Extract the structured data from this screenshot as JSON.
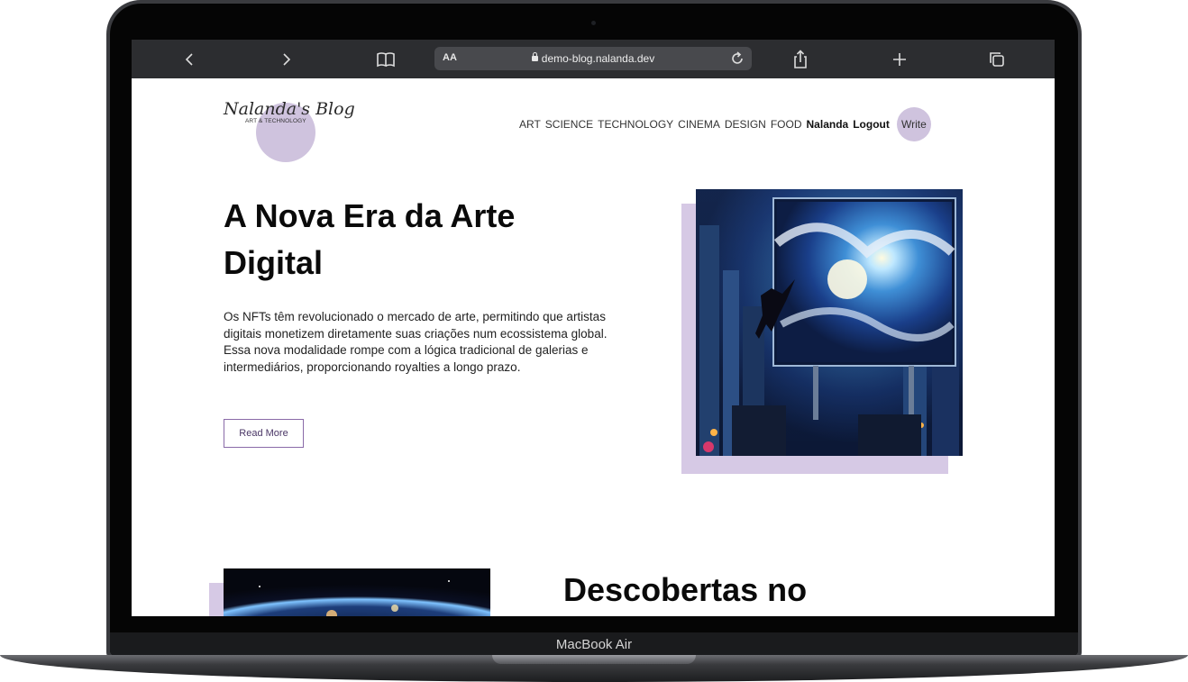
{
  "device": {
    "model_label": "MacBook Air"
  },
  "browser": {
    "text_size_label": "AA",
    "url": "demo-blog.nalanda.dev"
  },
  "site": {
    "logo_title": "Nalanda's Blog",
    "logo_subtitle": "ART & TECHNOLOGY",
    "nav": {
      "categories": [
        "ART",
        "SCIENCE",
        "TECHNOLOGY",
        "CINEMA",
        "DESIGN",
        "FOOD"
      ],
      "user": "Nalanda",
      "logout": "Logout",
      "write": "Write"
    }
  },
  "posts": [
    {
      "title": "A Nova Era da Arte Digital",
      "excerpt": "Os NFTs têm revolucionado o mercado de arte, permitindo que artistas digitais monetizem diretamente suas criações num ecossistema global. Essa nova modalidade rompe com a lógica tradicional de galerias e intermediários, proporcionando royalties a longo prazo.",
      "read_more": "Read More"
    },
    {
      "title": "Descobertas no"
    }
  ],
  "colors": {
    "accent_lavender": "#cfc3de",
    "button_border": "#8a6aa8",
    "browser_bar": "#2c2d30"
  }
}
